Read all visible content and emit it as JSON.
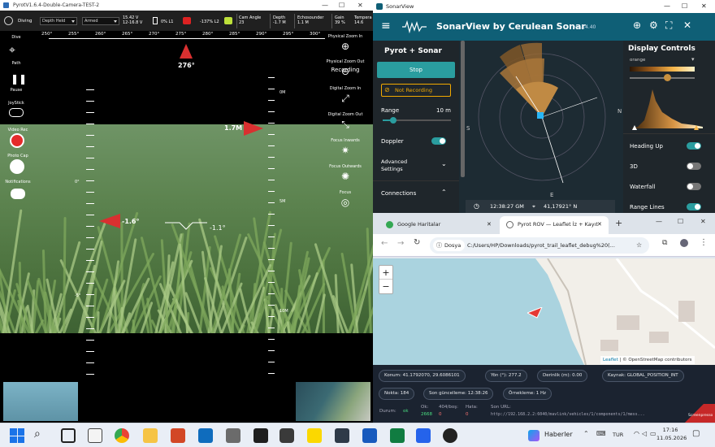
{
  "pyrot": {
    "window_title": "PyrotV1.6.4-Double-Camera-TEST-2",
    "mode_label": "Diving",
    "depth_mode": "Depth Held",
    "arm_state": "Armed",
    "voltage1": "15.42 V",
    "voltage2": "12-16.8 V",
    "light1": "0% L1",
    "light2": "-137% L2",
    "cam_angle_label": "Cam Angle",
    "cam_angle_value": "23",
    "depth_label": "Depth",
    "depth_value": "-1.7 M",
    "echo_label": "Echosounder",
    "echo_value": "1.1 M",
    "gain_label": "Gain",
    "gain_value": "39 %",
    "temp_label": "Tempera",
    "temp_value": "14.6",
    "compass_ticks": [
      "250°",
      "255°",
      "260°",
      "265°",
      "270°",
      "275°",
      "280°",
      "285°",
      "290°",
      "295°",
      "300°"
    ],
    "heading": "276°",
    "pitch_value": "-1.6°",
    "roll_value": "-1.1°",
    "depth_marker": "1.7M",
    "depth_scale": [
      "0M",
      "5M",
      "10M"
    ],
    "pitch_scale": [
      "0°",
      "-5°"
    ],
    "left_buttons": [
      {
        "label": "Dive"
      },
      {
        "label": "Path"
      },
      {
        "label": "Pause"
      },
      {
        "label": "JoyStick"
      },
      {
        "label": "Video Rec"
      },
      {
        "label": "Photo Cap"
      },
      {
        "label": "Notifications"
      }
    ],
    "right_tools": [
      {
        "label": "Physical Zoom In"
      },
      {
        "label": "Physical Zoom Out"
      },
      {
        "label": "Recording"
      },
      {
        "label": "Digital Zoom In"
      },
      {
        "label": "Digital Zoom Out"
      },
      {
        "label": "Focus Inwards"
      },
      {
        "label": "Focus Outwards"
      },
      {
        "label": "Focus"
      }
    ]
  },
  "sonar": {
    "window_title": "SonarView",
    "app_title": "SonarView by Cerulean Sonar",
    "version": "v 1.14.40",
    "section_title": "Pyrot + Sonar",
    "stop_label": "Stop",
    "recording_label": "Not Recording",
    "range_label": "Range",
    "range_value": "10 m",
    "range_level": 0.15,
    "doppler_label": "Doppler",
    "advanced_label": "Advanced Settings",
    "connections_label": "Connections",
    "time": "12:38:27 GM",
    "coords": "41,17921° N",
    "display_title": "Display Controls",
    "palette": "orange",
    "heading_up_label": "Heading Up",
    "three_d_label": "3D",
    "waterfall_label": "Waterfall",
    "range_lines_label": "Range Lines",
    "compass_n": "N",
    "compass_s": "S",
    "compass_e": "E",
    "colors": {
      "header": "#0f5f76",
      "accent": "#2a9d9f",
      "warn": "#f2a900"
    }
  },
  "browser": {
    "tabs": [
      {
        "label": "Google Haritalar",
        "active": false
      },
      {
        "label": "Pyrot ROV — Leaflet İz + Kayıt",
        "active": true
      }
    ],
    "address_prefix": "Dosya",
    "address": "C:/Users/HP/Downloads/pyrot_trail_leaflet_debug%20(...",
    "zoom_in": "+",
    "zoom_out": "−",
    "attribution_leaflet": "Leaflet",
    "attribution_osm": "| © OpenStreetMap contributors",
    "info": {
      "konum": "Konum: 41.1792070, 29.6086101",
      "yon": "Yön (°): 277.2",
      "derinlik": "Derinlik (m): 0.00",
      "kaynak": "Kaynak: GLOBAL_POSITION_INT",
      "nokta": "Nokta: 184",
      "son_guncelleme": "Son güncelleme: 12:38:26",
      "orneklem": "Örnekleme: 1 Hz"
    },
    "status": {
      "durum_label": "Durum:",
      "durum_value": "ok",
      "ok_label": "Ok:",
      "ok_value": "2668",
      "bos_label": "404/boş:",
      "bos_value": "0",
      "hata_label": "Hata:",
      "hata_value": "0",
      "url_label": "Son URL:",
      "url_value": "http://192.168.2.2:6040/mavlink/vehicles/1/components/1/mess..."
    },
    "screenpresso": "Screenpresso"
  },
  "taskbar": {
    "news_label": "Haberler",
    "lang": "TUR",
    "time": "17:16",
    "date": "11.05.2026"
  }
}
